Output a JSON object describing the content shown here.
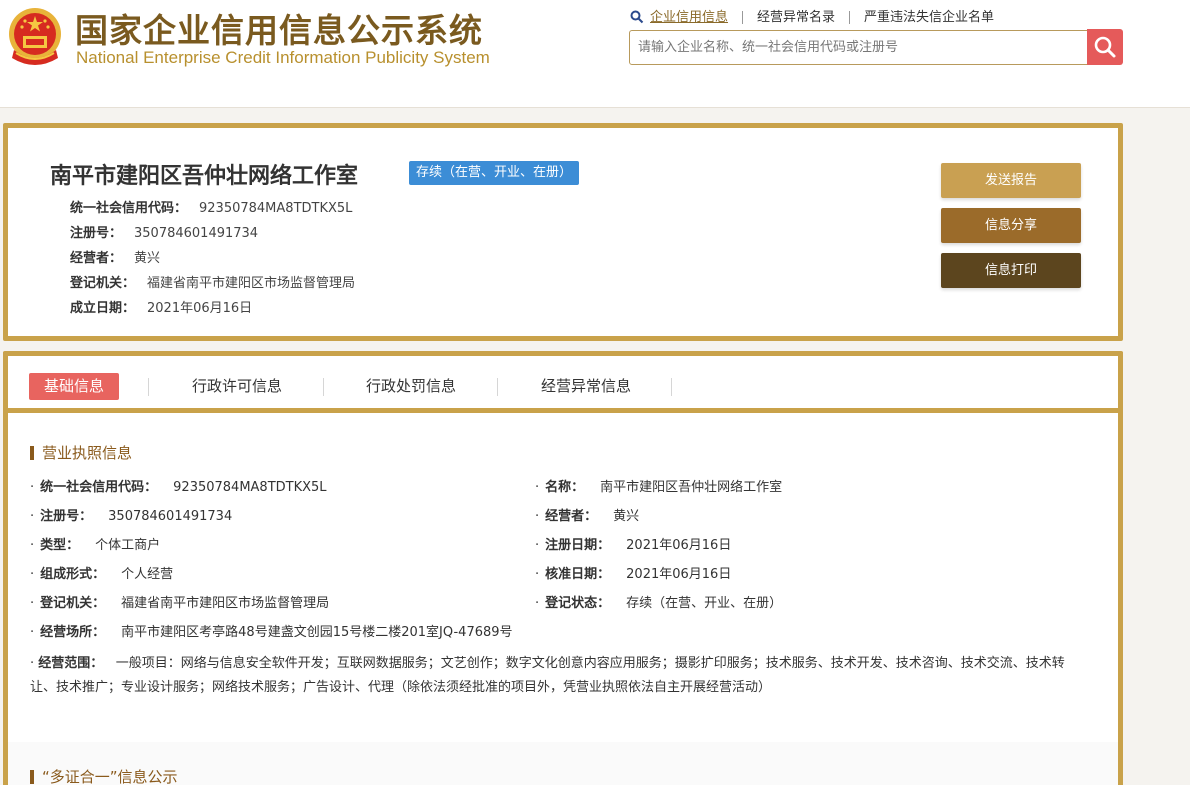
{
  "header": {
    "title_cn": "国家企业信用信息公示系统",
    "title_en": "National Enterprise Credit Information Publicity System",
    "nav": [
      {
        "label": "企业信用信息"
      },
      {
        "label": "经营异常名录"
      },
      {
        "label": "严重违法失信企业名单"
      }
    ],
    "search_placeholder": "请输入企业名称、统一社会信用代码或注册号"
  },
  "company": {
    "name": "南平市建阳区吾仲壮网络工作室",
    "status": "存续（在营、开业、在册）",
    "summary": [
      {
        "label": "统一社会信用代码：",
        "value": "92350784MA8TDTKX5L"
      },
      {
        "label": "注册号：",
        "value": "350784601491734"
      },
      {
        "label": "经营者：",
        "value": "黄兴"
      },
      {
        "label": "登记机关：",
        "value": "福建省南平市建阳区市场监督管理局"
      },
      {
        "label": "成立日期：",
        "value": "2021年06月16日"
      }
    ],
    "actions": {
      "report": "发送报告",
      "share": "信息分享",
      "print": "信息打印"
    }
  },
  "tabs": [
    {
      "label": "基础信息"
    },
    {
      "label": "行政许可信息"
    },
    {
      "label": "行政处罚信息"
    },
    {
      "label": "经营异常信息"
    }
  ],
  "license": {
    "title": "营业执照信息",
    "fields_left": [
      {
        "label": "统一社会信用代码：",
        "value": "92350784MA8TDTKX5L"
      },
      {
        "label": "注册号：",
        "value": "350784601491734"
      },
      {
        "label": "类型：",
        "value": "个体工商户"
      },
      {
        "label": "组成形式：",
        "value": "个人经营"
      },
      {
        "label": "登记机关：",
        "value": "福建省南平市建阳区市场监督管理局"
      },
      {
        "label": "经营场所：",
        "value": "南平市建阳区考亭路48号建盏文创园15号楼二楼201室JQ-47689号"
      }
    ],
    "fields_right": [
      {
        "label": "名称：",
        "value": "南平市建阳区吾仲壮网络工作室"
      },
      {
        "label": "经营者：",
        "value": "黄兴"
      },
      {
        "label": "注册日期：",
        "value": "2021年06月16日"
      },
      {
        "label": "核准日期：",
        "value": "2021年06月16日"
      },
      {
        "label": "登记状态：",
        "value": "存续（在营、开业、在册）"
      }
    ],
    "scope_label": "经营范围：",
    "scope_value": "一般项目：网络与信息安全软件开发；互联网数据服务；文艺创作；数字文化创意内容应用服务；摄影扩印服务；技术服务、技术开发、技术咨询、技术交流、技术转让、技术推广；专业设计服务；网络技术服务；广告设计、代理（除依法须经批准的项目外，凭营业执照依法自主开展经营活动）"
  },
  "multi_cert": {
    "title": "“多证合一”信息公示"
  },
  "colors": {
    "gold": "#c9a24a",
    "brown": "#8a5a1c",
    "badge": "#3c8dd6",
    "tab_active": "#e8645f"
  }
}
